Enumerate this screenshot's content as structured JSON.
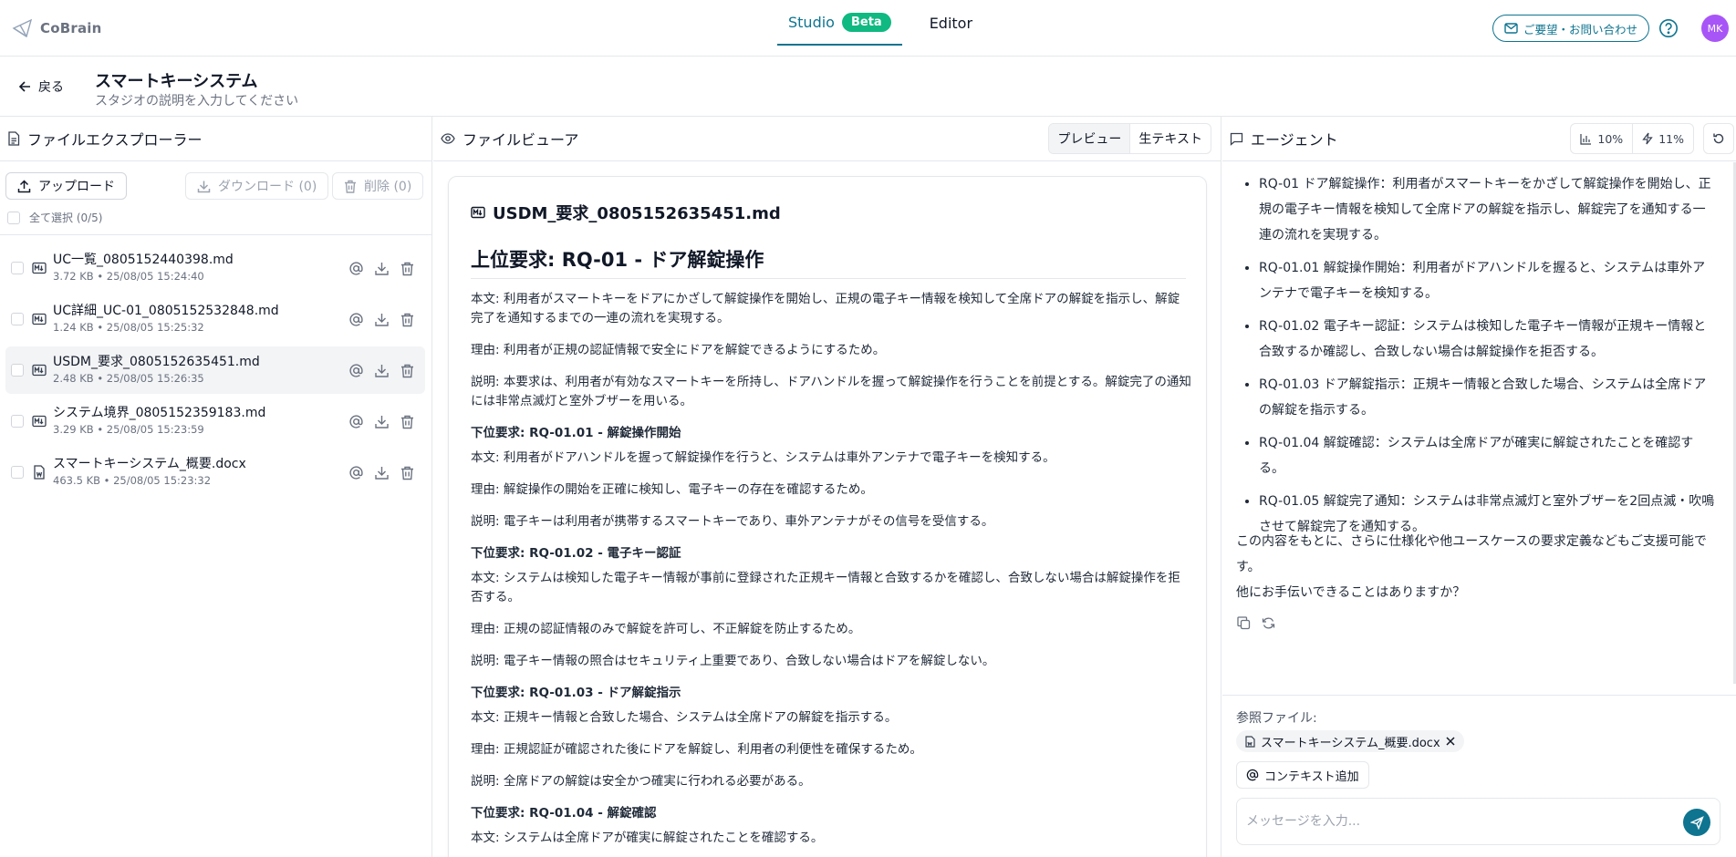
{
  "app": {
    "logo_text": "CoBrain",
    "tabs": [
      {
        "label": "Studio",
        "badge": "Beta"
      },
      {
        "label": "Editor"
      }
    ],
    "contact_label": "ご要望・お問い合わせ",
    "avatar_initials": "MK"
  },
  "studio": {
    "back_label": "戻る",
    "title": "スマートキーシステム",
    "description": "スタジオの説明を入力してください"
  },
  "explorer": {
    "title": "ファイルエクスプローラー",
    "upload_label": "アップロード",
    "download_label": "ダウンロード (0)",
    "delete_label": "削除 (0)",
    "select_all_label": "全て選択 (0/5)",
    "files": [
      {
        "name": "UC一覧_0805152440398.md",
        "meta": "3.72 KB • 25/08/05 15:24:40"
      },
      {
        "name": "UC詳細_UC-01_0805152532848.md",
        "meta": "1.24 KB • 25/08/05 15:25:32"
      },
      {
        "name": "USDM_要求_0805152635451.md",
        "meta": "2.48 KB • 25/08/05 15:26:35"
      },
      {
        "name": "システム境界_0805152359183.md",
        "meta": "3.29 KB • 25/08/05 15:23:59"
      },
      {
        "name": "スマートキーシステム_概要.docx",
        "meta": "463.5 KB • 25/08/05 15:23:32"
      }
    ]
  },
  "viewer": {
    "title": "ファイルビューア",
    "mode_preview": "プレビュー",
    "mode_raw": "生テキスト",
    "file_name": "USDM_要求_0805152635451.md",
    "heading": "上位要求: RQ-01 - ドア解錠操作",
    "p1": "本文: 利用者がスマートキーをドアにかざして解錠操作を開始し、正規の電子キー情報を検知して全席ドアの解錠を指示し、解錠完了を通知するまでの一連の流れを実現する。",
    "p2": "理由: 利用者が正規の認証情報で安全にドアを解錠できるようにするため。",
    "p3": "説明: 本要求は、利用者が有効なスマートキーを所持し、ドアハンドルを握って解錠操作を行うことを前提とする。解錠完了の通知には非常点滅灯と室外ブザーを用いる。",
    "s1_title": "下位要求: RQ-01.01 - 解錠操作開始",
    "s1_body": "本文: 利用者がドアハンドルを握って解錠操作を行うと、システムは車外アンテナで電子キーを検知する。",
    "s1_reason": "理由: 解錠操作の開始を正確に検知し、電子キーの存在を確認するため。",
    "s1_desc": "説明: 電子キーは利用者が携帯するスマートキーであり、車外アンテナがその信号を受信する。",
    "s2_title": "下位要求: RQ-01.02 - 電子キー認証",
    "s2_body": "本文: システムは検知した電子キー情報が事前に登録された正規キー情報と合致するかを確認し、合致しない場合は解錠操作を拒否する。",
    "s2_reason": "理由: 正規の認証情報のみで解錠を許可し、不正解錠を防止するため。",
    "s2_desc": "説明: 電子キー情報の照合はセキュリティ上重要であり、合致しない場合はドアを解錠しない。",
    "s3_title": "下位要求: RQ-01.03 - ドア解錠指示",
    "s3_body": "本文: 正規キー情報と合致した場合、システムは全席ドアの解錠を指示する。",
    "s3_reason": "理由: 正規認証が確認された後にドアを解錠し、利用者の利便性を確保するため。",
    "s3_desc": "説明: 全席ドアの解錠は安全かつ確実に行われる必要がある。",
    "s4_title": "下位要求: RQ-01.04 - 解錠確認",
    "s4_body": "本文: システムは全席ドアが確実に解錠されたことを確認する。"
  },
  "agent": {
    "title": "エージェント",
    "stat1": "10%",
    "stat2": "11%",
    "items": [
      "RQ-01 ドア解錠操作：利用者がスマートキーをかざして解錠操作を開始し、正規の電子キー情報を検知して全席ドアの解錠を指示し、解錠完了を通知する一連の流れを実現する。",
      "RQ-01.01 解錠操作開始：利用者がドアハンドルを握ると、システムは車外アンテナで電子キーを検知する。",
      "RQ-01.02 電子キー認証：システムは検知した電子キー情報が正規キー情報と合致するか確認し、合致しない場合は解錠操作を拒否する。",
      "RQ-01.03 ドア解錠指示：正規キー情報と合致した場合、システムは全席ドアの解錠を指示する。",
      "RQ-01.04 解錠確認：システムは全席ドアが確実に解錠されたことを確認する。",
      "RQ-01.05 解錠完了通知：システムは非常点滅灯と室外ブザーを2回点滅・吹鳴させて解錠完了を通知する。"
    ],
    "closing1": "この内容をもとに、さらに仕様化や他ユースケースの要求定義などもご支援可能です。",
    "closing2": "他にお手伝いできることはありますか？",
    "ref_label": "参照ファイル:",
    "ref_file": "スマートキーシステム_概要.docx",
    "context_label": "コンテキスト追加",
    "input_placeholder": "メッセージを入力..."
  }
}
